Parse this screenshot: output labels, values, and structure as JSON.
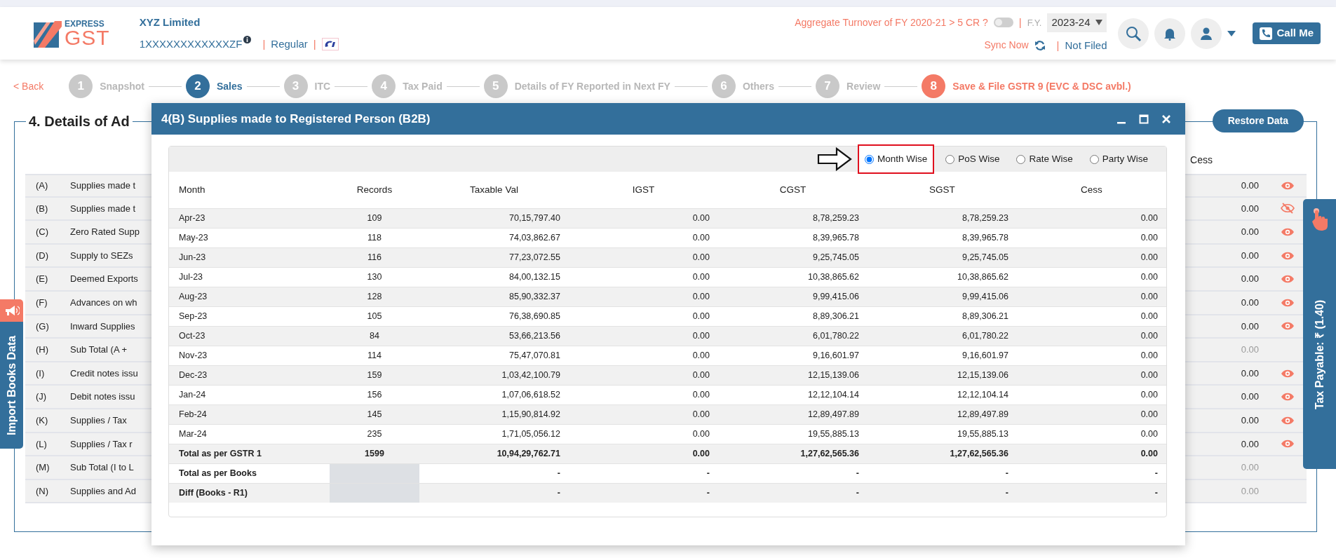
{
  "header": {
    "logo_top": "EXPRESS",
    "logo_bottom": "GST",
    "company": "XYZ Limited",
    "gstin": "1XXXXXXXXXXXXZF",
    "registration_type": "Regular",
    "separator": "|",
    "turnover_question": "Aggregate Turnover of FY 2020-21 > 5 CR ?",
    "turnover_toggle_on": false,
    "fy_label": "F.Y.",
    "fy_value": "2023-24",
    "sync_label": "Sync Now",
    "filing_status": "Not Filed",
    "call_button": "Call Me"
  },
  "stepper": {
    "back": "< Back",
    "steps": [
      {
        "number": "1",
        "label": "Snapshot",
        "selected": false,
        "kind": "step"
      },
      {
        "number": "2",
        "label": "Sales",
        "selected": true,
        "kind": "step"
      },
      {
        "number": "3",
        "label": "ITC",
        "selected": false,
        "kind": "step"
      },
      {
        "number": "4",
        "label": "Tax Paid",
        "selected": false,
        "kind": "step"
      },
      {
        "number": "5",
        "label": "Details of FY Reported in Next FY",
        "selected": false,
        "kind": "step"
      },
      {
        "number": "6",
        "label": "Others",
        "selected": false,
        "kind": "step"
      },
      {
        "number": "7",
        "label": "Review",
        "selected": false,
        "kind": "step"
      },
      {
        "number": "8",
        "label": "Save & File GSTR 9 (EVC & DSC avbl.)",
        "selected": false,
        "kind": "final"
      }
    ]
  },
  "section": {
    "title": "4. Details of Ad",
    "restore_button": "Restore Data",
    "cess_heading": "Cess",
    "rows": [
      {
        "code": "(A)",
        "label": "Supplies made t",
        "cess": "0.00",
        "kind": "viewable"
      },
      {
        "code": "(B)",
        "label": "Supplies made t",
        "cess": "0.00",
        "kind": "hidden"
      },
      {
        "code": "(C)",
        "label": "Zero Rated Supp",
        "cess": "0.00",
        "kind": "viewable"
      },
      {
        "code": "(D)",
        "label": "Supply to SEZs",
        "cess": "0.00",
        "kind": "viewable"
      },
      {
        "code": "(E)",
        "label": "Deemed Exports",
        "cess": "0.00",
        "kind": "viewable"
      },
      {
        "code": "(F)",
        "label": "Advances on wh",
        "cess": "0.00",
        "kind": "viewable"
      },
      {
        "code": "(G)",
        "label": "Inward Supplies",
        "cess": "0.00",
        "kind": "viewable"
      },
      {
        "code": "(H)",
        "label": "Sub Total (A +",
        "cess": "0.00",
        "kind": "disabled"
      },
      {
        "code": "(I)",
        "label": "Credit notes issu",
        "cess": "0.00",
        "kind": "viewable"
      },
      {
        "code": "(J)",
        "label": "Debit notes issu",
        "cess": "0.00",
        "kind": "viewable"
      },
      {
        "code": "(K)",
        "label": "Supplies / Tax",
        "cess": "0.00",
        "kind": "viewable"
      },
      {
        "code": "(L)",
        "label": "Supplies / Tax r",
        "cess": "0.00",
        "kind": "viewable"
      },
      {
        "code": "(M)",
        "label": "Sub Total (I to L",
        "cess": "0.00",
        "kind": "disabled"
      },
      {
        "code": "(N)",
        "label": "Supplies and Ad",
        "cess": "0.00",
        "kind": "disabled"
      }
    ]
  },
  "side_tabs": {
    "import": "Import Books Data",
    "tax_payable": "Tax Payable: ₹ (1.40)"
  },
  "modal": {
    "title": "4(B) Supplies made to Registered Person (B2B)",
    "views": [
      {
        "label": "Month Wise",
        "selected": true,
        "highlighted": true
      },
      {
        "label": "PoS Wise",
        "selected": false,
        "highlighted": false
      },
      {
        "label": "Rate Wise",
        "selected": false,
        "highlighted": false
      },
      {
        "label": "Party Wise",
        "selected": false,
        "highlighted": false
      }
    ],
    "columns": [
      "Month",
      "Records",
      "Taxable Val",
      "IGST",
      "CGST",
      "SGST",
      "Cess"
    ],
    "rows": [
      {
        "kind": "month",
        "cells": [
          "Apr-23",
          "109",
          "70,15,797.40",
          "0.00",
          "8,78,259.23",
          "8,78,259.23",
          "0.00"
        ]
      },
      {
        "kind": "month",
        "cells": [
          "May-23",
          "118",
          "74,03,862.67",
          "0.00",
          "8,39,965.78",
          "8,39,965.78",
          "0.00"
        ]
      },
      {
        "kind": "month",
        "cells": [
          "Jun-23",
          "116",
          "77,23,072.55",
          "0.00",
          "9,25,745.05",
          "9,25,745.05",
          "0.00"
        ]
      },
      {
        "kind": "month",
        "cells": [
          "Jul-23",
          "130",
          "84,00,132.15",
          "0.00",
          "10,38,865.62",
          "10,38,865.62",
          "0.00"
        ]
      },
      {
        "kind": "month",
        "cells": [
          "Aug-23",
          "128",
          "85,90,332.37",
          "0.00",
          "9,99,415.06",
          "9,99,415.06",
          "0.00"
        ]
      },
      {
        "kind": "month",
        "cells": [
          "Sep-23",
          "105",
          "76,38,690.85",
          "0.00",
          "8,89,306.21",
          "8,89,306.21",
          "0.00"
        ]
      },
      {
        "kind": "month",
        "cells": [
          "Oct-23",
          "84",
          "53,66,213.56",
          "0.00",
          "6,01,780.22",
          "6,01,780.22",
          "0.00"
        ]
      },
      {
        "kind": "month",
        "cells": [
          "Nov-23",
          "114",
          "75,47,070.81",
          "0.00",
          "9,16,601.97",
          "9,16,601.97",
          "0.00"
        ]
      },
      {
        "kind": "month",
        "cells": [
          "Dec-23",
          "159",
          "1,03,42,100.79",
          "0.00",
          "12,15,139.06",
          "12,15,139.06",
          "0.00"
        ]
      },
      {
        "kind": "month",
        "cells": [
          "Jan-24",
          "156",
          "1,07,06,618.52",
          "0.00",
          "12,12,104.14",
          "12,12,104.14",
          "0.00"
        ]
      },
      {
        "kind": "month",
        "cells": [
          "Feb-24",
          "145",
          "1,15,90,814.92",
          "0.00",
          "12,89,497.89",
          "12,89,497.89",
          "0.00"
        ]
      },
      {
        "kind": "month",
        "cells": [
          "Mar-24",
          "235",
          "1,71,05,056.12",
          "0.00",
          "19,55,885.13",
          "19,55,885.13",
          "0.00"
        ]
      },
      {
        "kind": "total",
        "cells": [
          "Total as per GSTR 1",
          "1599",
          "10,94,29,762.71",
          "0.00",
          "1,27,62,565.36",
          "1,27,62,565.36",
          "0.00"
        ]
      },
      {
        "kind": "comparison",
        "cells": [
          "Total as per Books",
          "-",
          "-",
          "-",
          "-",
          "-"
        ]
      },
      {
        "kind": "comparison",
        "cells": [
          "Diff (Books - R1)",
          "-",
          "-",
          "-",
          "-",
          "-"
        ]
      }
    ]
  }
}
